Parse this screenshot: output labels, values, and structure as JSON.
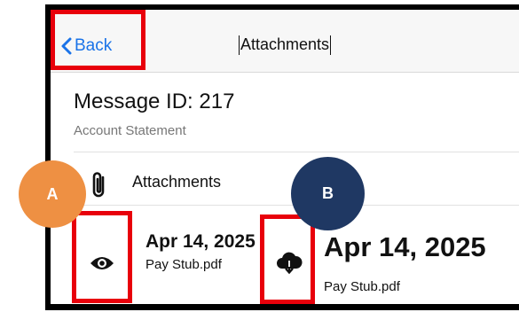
{
  "nav": {
    "back_label": "Back",
    "title": "Attachments"
  },
  "message": {
    "id_label": "Message ID: 217",
    "subject": "Account Statement"
  },
  "attachments_header": {
    "label": "Attachments"
  },
  "rows": [
    {
      "date": "Apr 14, 2025",
      "filename": "Pay Stub.pdf",
      "action_icon": "eye-icon"
    },
    {
      "date": "Apr 14, 2025",
      "filename": "Pay Stub.pdf",
      "action_icon": "cloud-download-icon"
    }
  ],
  "annotations": {
    "a": "A",
    "b": "B",
    "a_color": "#ee9043",
    "b_color": "#1f3863",
    "highlight_color": "#e8000b"
  },
  "colors": {
    "accent": "#1a73e8"
  }
}
